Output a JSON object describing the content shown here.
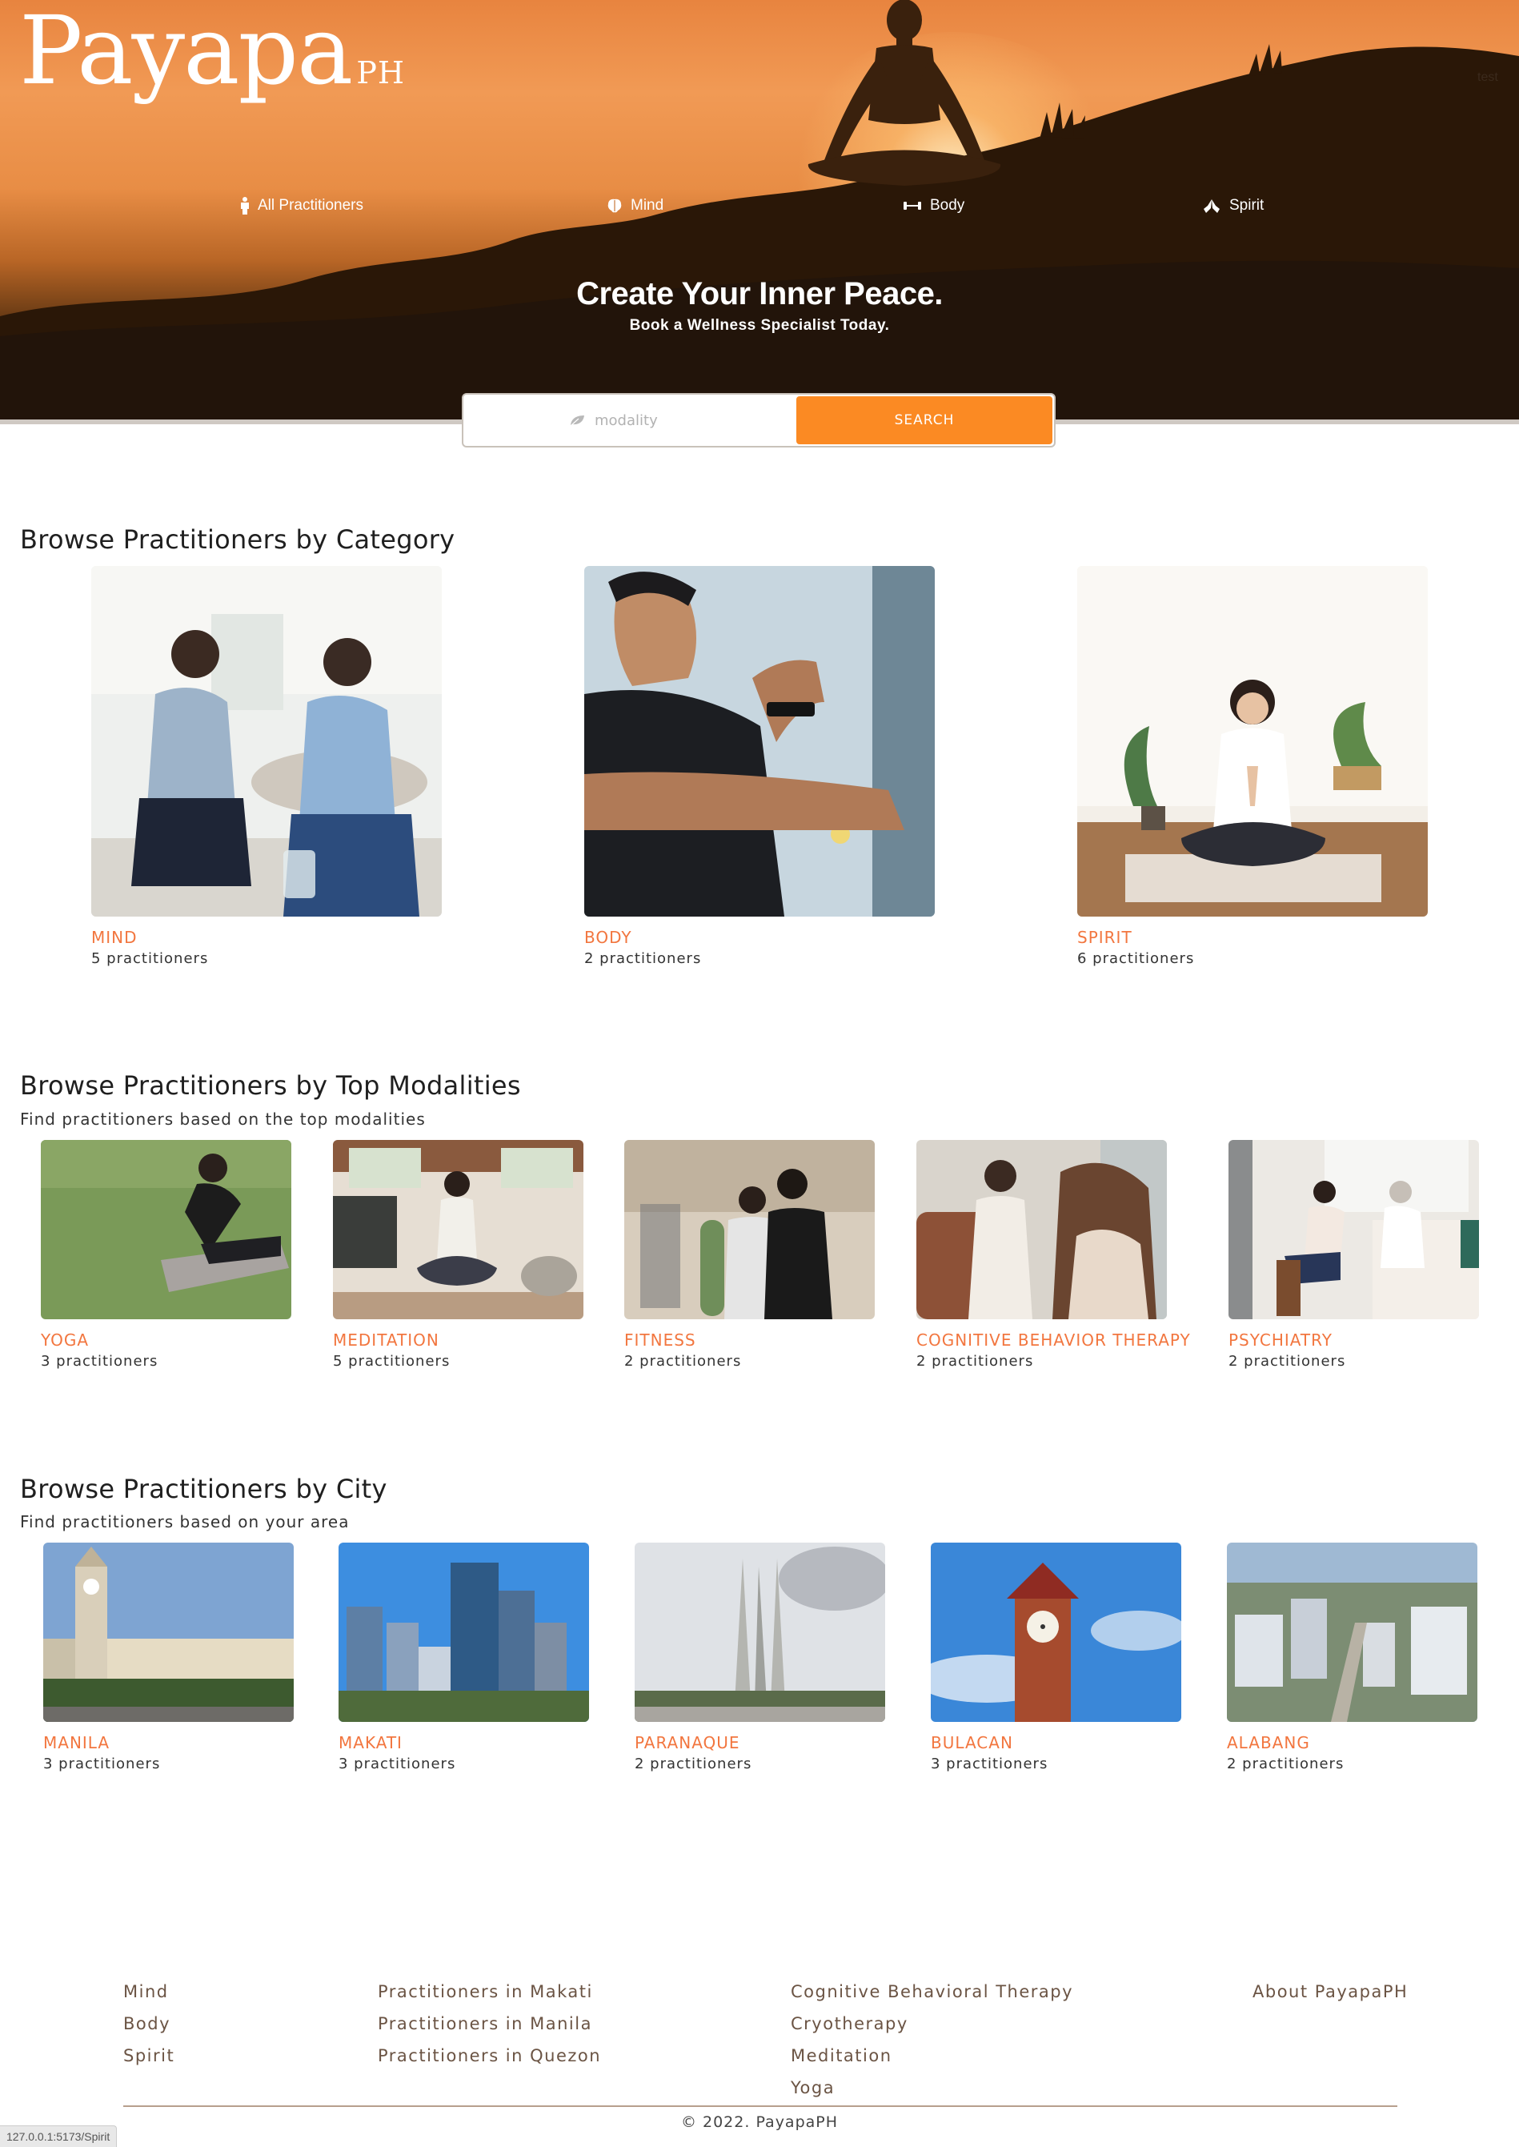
{
  "header": {
    "logo_main": "Payapa",
    "logo_sub": "PH",
    "corner_text": "test",
    "nav": [
      {
        "label": "All Practitioners",
        "icon": "person-icon"
      },
      {
        "label": "Mind",
        "icon": "brain-icon"
      },
      {
        "label": "Body",
        "icon": "dumbbell-icon"
      },
      {
        "label": "Spirit",
        "icon": "praying-hands-icon"
      }
    ],
    "headline": "Create Your Inner Peace.",
    "subheadline": "Book a Wellness Specialist Today."
  },
  "search": {
    "placeholder": "modality",
    "button_label": "SEARCH",
    "icon": "leaf-icon"
  },
  "categories": {
    "title": "Browse Practitioners by Category",
    "items": [
      {
        "name": "MIND",
        "count": "5 practitioners"
      },
      {
        "name": "BODY",
        "count": "2 practitioners"
      },
      {
        "name": "SPIRIT",
        "count": "6 practitioners"
      }
    ]
  },
  "modalities": {
    "title": "Browse Practitioners by Top Modalities",
    "subtitle": "Find practitioners based on the top modalities",
    "items": [
      {
        "name": "YOGA",
        "count": "3 practitioners"
      },
      {
        "name": "MEDITATION",
        "count": "5 practitioners"
      },
      {
        "name": "FITNESS",
        "count": "2 practitioners"
      },
      {
        "name": "COGNITIVE BEHAVIOR THERAPY",
        "count": "2 practitioners"
      },
      {
        "name": "PSYCHIATRY",
        "count": "2 practitioners"
      }
    ]
  },
  "cities": {
    "title": "Browse Practitioners by City",
    "subtitle": "Find practitioners based on your area",
    "items": [
      {
        "name": "MANILA",
        "count": "3 practitioners"
      },
      {
        "name": "MAKATI",
        "count": "3 practitioners"
      },
      {
        "name": "PARANAQUE",
        "count": "2 practitioners"
      },
      {
        "name": "BULACAN",
        "count": "3 practitioners"
      },
      {
        "name": "ALABANG",
        "count": "2 practitioners"
      }
    ]
  },
  "footer": {
    "col1": [
      "Mind",
      "Body",
      "Spirit"
    ],
    "col2": [
      "Practitioners in Makati",
      "Practitioners in Manila",
      "Practitioners in Quezon"
    ],
    "col3": [
      "Cognitive Behavioral Therapy",
      "Cryotherapy",
      "Meditation",
      "Yoga"
    ],
    "col4": [
      "About PayapaPH"
    ],
    "copyright": "© 2022. PayapaPH"
  },
  "status_bar": "127.0.0.1:5173/Spirit",
  "colors": {
    "accent": "#fb8a23",
    "label": "#f2763f",
    "footer_link": "#6b5444"
  }
}
